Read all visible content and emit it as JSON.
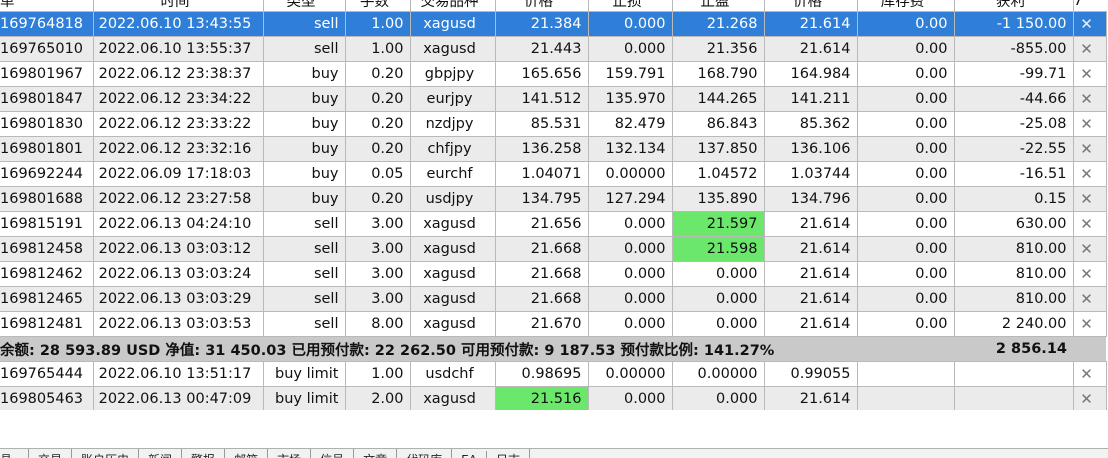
{
  "header": {
    "columns": [
      "单",
      "时间",
      "类型",
      "手数",
      "交易品种",
      "价格",
      "止损",
      "止盈",
      "价格",
      "库存费",
      "获利"
    ],
    "sort_marker": "7"
  },
  "positions": [
    {
      "id": "169764818",
      "time": "2022.06.10 13:43:55",
      "type": "sell",
      "volume": "1.00",
      "symbol": "xagusd",
      "open": "21.384",
      "sl": "0.000",
      "tp": "21.268",
      "price": "21.614",
      "swap": "0.00",
      "profit": "-1 150.00",
      "state": "selected"
    },
    {
      "id": "169765010",
      "time": "2022.06.10 13:55:37",
      "type": "sell",
      "volume": "1.00",
      "symbol": "xagusd",
      "open": "21.443",
      "sl": "0.000",
      "tp": "21.356",
      "price": "21.614",
      "swap": "0.00",
      "profit": "-855.00",
      "state": "zebra"
    },
    {
      "id": "169801967",
      "time": "2022.06.12 23:38:37",
      "type": "buy",
      "volume": "0.20",
      "symbol": "gbpjpy",
      "open": "165.656",
      "sl": "159.791",
      "tp": "168.790",
      "price": "164.984",
      "swap": "0.00",
      "profit": "-99.71",
      "state": ""
    },
    {
      "id": "169801847",
      "time": "2022.06.12 23:34:22",
      "type": "buy",
      "volume": "0.20",
      "symbol": "eurjpy",
      "open": "141.512",
      "sl": "135.970",
      "tp": "144.265",
      "price": "141.211",
      "swap": "0.00",
      "profit": "-44.66",
      "state": "zebra"
    },
    {
      "id": "169801830",
      "time": "2022.06.12 23:33:22",
      "type": "buy",
      "volume": "0.20",
      "symbol": "nzdjpy",
      "open": "85.531",
      "sl": "82.479",
      "tp": "86.843",
      "price": "85.362",
      "swap": "0.00",
      "profit": "-25.08",
      "state": ""
    },
    {
      "id": "169801801",
      "time": "2022.06.12 23:32:16",
      "type": "buy",
      "volume": "0.20",
      "symbol": "chfjpy",
      "open": "136.258",
      "sl": "132.134",
      "tp": "137.850",
      "price": "136.106",
      "swap": "0.00",
      "profit": "-22.55",
      "state": "zebra"
    },
    {
      "id": "169692244",
      "time": "2022.06.09 17:18:03",
      "type": "buy",
      "volume": "0.05",
      "symbol": "eurchf",
      "open": "1.04071",
      "sl": "0.00000",
      "tp": "1.04572",
      "price": "1.03744",
      "swap": "0.00",
      "profit": "-16.51",
      "state": ""
    },
    {
      "id": "169801688",
      "time": "2022.06.12 23:27:58",
      "type": "buy",
      "volume": "0.20",
      "symbol": "usdjpy",
      "open": "134.795",
      "sl": "127.294",
      "tp": "135.890",
      "price": "134.796",
      "swap": "0.00",
      "profit": "0.15",
      "state": "zebra"
    },
    {
      "id": "169815191",
      "time": "2022.06.13 04:24:10",
      "type": "sell",
      "volume": "3.00",
      "symbol": "xagusd",
      "open": "21.656",
      "sl": "0.000",
      "tp": "21.597",
      "price": "21.614",
      "swap": "0.00",
      "profit": "630.00",
      "state": "",
      "hl": "tp"
    },
    {
      "id": "169812458",
      "time": "2022.06.13 03:03:12",
      "type": "sell",
      "volume": "3.00",
      "symbol": "xagusd",
      "open": "21.668",
      "sl": "0.000",
      "tp": "21.598",
      "price": "21.614",
      "swap": "0.00",
      "profit": "810.00",
      "state": "zebra",
      "hl": "tp"
    },
    {
      "id": "169812462",
      "time": "2022.06.13 03:03:24",
      "type": "sell",
      "volume": "3.00",
      "symbol": "xagusd",
      "open": "21.668",
      "sl": "0.000",
      "tp": "0.000",
      "price": "21.614",
      "swap": "0.00",
      "profit": "810.00",
      "state": ""
    },
    {
      "id": "169812465",
      "time": "2022.06.13 03:03:29",
      "type": "sell",
      "volume": "3.00",
      "symbol": "xagusd",
      "open": "21.668",
      "sl": "0.000",
      "tp": "0.000",
      "price": "21.614",
      "swap": "0.00",
      "profit": "810.00",
      "state": "zebra"
    },
    {
      "id": "169812481",
      "time": "2022.06.13 03:03:53",
      "type": "sell",
      "volume": "8.00",
      "symbol": "xagusd",
      "open": "21.670",
      "sl": "0.000",
      "tp": "0.000",
      "price": "21.614",
      "swap": "0.00",
      "profit": "2 240.00",
      "state": ""
    }
  ],
  "summary": {
    "text": "余额: 28 593.89 USD  净值: 31 450.03  已用预付款: 22 262.50  可用预付款: 9 187.53  预付款比例: 141.27%",
    "total_profit": "2 856.14"
  },
  "orders": [
    {
      "id": "169765444",
      "time": "2022.06.10 13:51:17",
      "type": "buy limit",
      "volume": "1.00",
      "symbol": "usdchf",
      "open": "0.98695",
      "sl": "0.00000",
      "tp": "0.00000",
      "price": "0.99055",
      "state": ""
    },
    {
      "id": "169805463",
      "time": "2022.06.13 00:47:09",
      "type": "buy limit",
      "volume": "2.00",
      "symbol": "xagusd",
      "open": "21.516",
      "sl": "0.000",
      "tp": "0.000",
      "price": "21.614",
      "state": "zebra",
      "hl": "open"
    }
  ],
  "close_glyph": "✕",
  "tabs": {
    "label": "具",
    "items": [
      "交易",
      "账户历史",
      "新闻",
      "警报",
      "邮箱",
      "市场",
      "信号",
      "文章",
      "代码库",
      "EA",
      "日志"
    ]
  }
}
